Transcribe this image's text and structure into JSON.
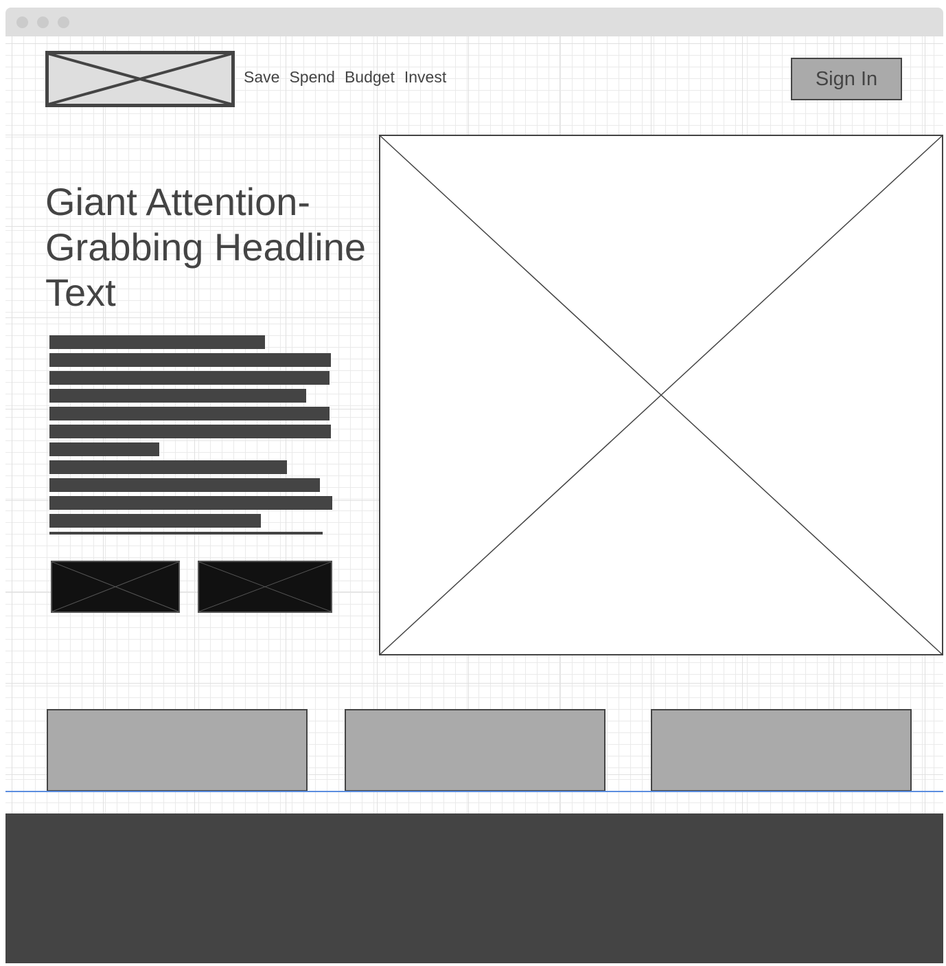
{
  "header": {
    "logo_icon": "image-placeholder-icon",
    "nav": [
      "Save",
      "Spend",
      "Budget",
      "Invest"
    ],
    "signin_label": "Sign In"
  },
  "hero": {
    "headline": "Giant Attention-Grabbing Headline Text",
    "body_icon": "redacted-text-block",
    "cta_icons": [
      "image-placeholder-icon",
      "image-placeholder-icon"
    ],
    "image_icon": "image-placeholder-icon"
  },
  "cards": [
    {},
    {},
    {}
  ],
  "colors": {
    "dark": "#444444",
    "placeholder_fill": "#aaaaaa",
    "button_fill": "#111111",
    "selection_line": "#5b8ddf",
    "titlebar": "#dedede"
  }
}
